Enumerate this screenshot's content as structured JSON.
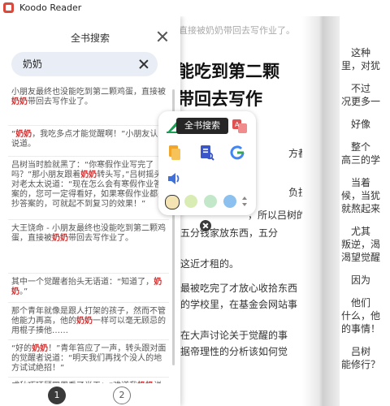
{
  "app": {
    "title": "Koodo Reader"
  },
  "sidebar": {
    "title": "全书搜索",
    "search_value": "奶奶",
    "results": [
      {
        "parts": [
          [
            "小朋友最终也没能吃到第二颗鸡蛋，直接被",
            ""
          ],
          [
            "奶奶",
            "hl"
          ],
          [
            "带回去写作业了。",
            ""
          ]
        ]
      },
      {
        "parts": [
          [
            "“",
            ""
          ],
          [
            "奶奶",
            "hl"
          ],
          [
            "，我吃多点才能觉醒啊！”小朋友认真说道。",
            ""
          ]
        ]
      },
      {
        "parts": [
          [
            "吕树当时脸就黑了：“你寒假作业写完了吗？”那小朋友跟着",
            ""
          ],
          [
            "奶奶",
            "hl"
          ],
          [
            "转头写，”吕树摇头对老太太说道：“现在怎么会有寒假作业答案的，您可一定得看好，如果寒假作业都是抄答案的，可就起不到复习的效果！”",
            ""
          ]
        ]
      },
      {
        "parts": [
          [
            "大王饶命 - 小朋友最终也没能吃到第二颗鸡蛋，直接被",
            ""
          ],
          [
            "奶奶",
            "hl"
          ],
          [
            "带回去写作业了。",
            ""
          ]
        ]
      },
      {
        "parts": [
          [
            "其中一个觉醒者抬头无语道：“知道了，",
            ""
          ],
          [
            "奶奶",
            "hl"
          ],
          [
            "。”",
            ""
          ]
        ]
      },
      {
        "parts": [
          [
            "那个青年就像是跟人打架的孩子，然而不管他能力再高，他的",
            ""
          ],
          [
            "奶奶",
            "hl"
          ],
          [
            "一样可以毫无顾忌的用棍子揍他……",
            ""
          ]
        ]
      },
      {
        "parts": [
          [
            "“好的",
            ""
          ],
          [
            "奶奶",
            "hl"
          ],
          [
            "！”青年笞应了一声，转头跟对面的觉醒者说道：“明天我们再找个没人的地方试试绝招！”",
            ""
          ]
        ]
      },
      {
        "parts": [
          [
            "成秋巧环顾四周看了半天：“难道我",
            ""
          ],
          [
            "奶奶",
            "hl"
          ],
          [
            "说的是真的？”",
            ""
          ]
        ]
      }
    ],
    "pages": [
      "1",
      "2"
    ]
  },
  "reader": {
    "top_line": "直接被奶奶带回去写作业了。",
    "headline_1": "能吃到第二颗",
    "headline_2": "带回去写作",
    "left_lines": [
      "方都没有",
      "负担。",
      "，所以吕树的生意",
      "五分钱家放东西，五分",
      "这近才租的。",
      "最被吃完了才放心收拾东西",
      "的学校里，在基金会网站事",
      "在大声讨论关于觉醒的事",
      "据帝理性的分析该如何觉"
    ],
    "right_lines": [
      "这种",
      "里，对犹",
      "不过",
      "况更多一",
      "好像",
      "整个",
      "高三的学",
      "当着",
      "候，当犹",
      "就熬起来",
      "尤其",
      "叛逆，渴",
      "渴望觉醒",
      "因为",
      "他们",
      "什么，他",
      "的事情！",
      "吕树",
      "能修行？"
    ]
  },
  "popup": {
    "label": "全书搜索",
    "colors": [
      "#f4e4b4",
      "#d9ecb4",
      "#c3e7c9",
      "#8cc0ee"
    ]
  }
}
